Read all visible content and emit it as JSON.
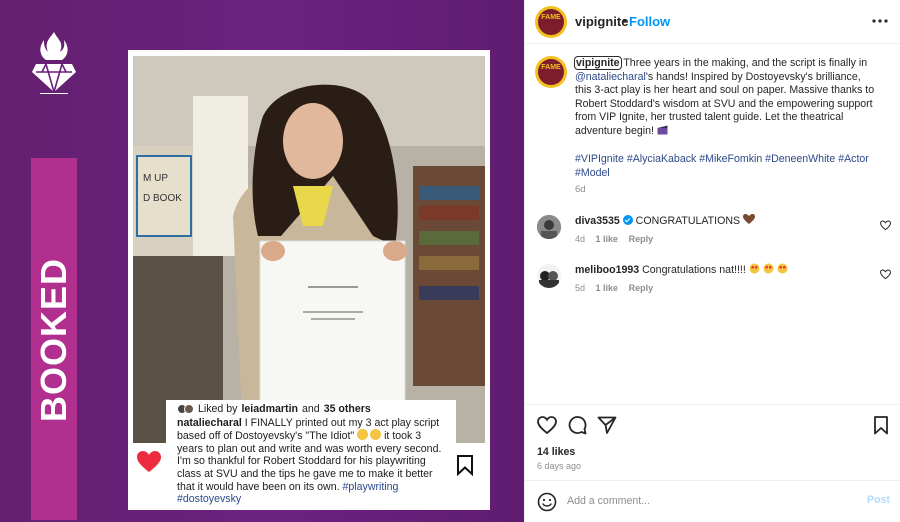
{
  "media": {
    "side_label": "BOOKED",
    "colors": {
      "purple": "#6a1f7b",
      "pink": "#b02f8f"
    },
    "embedded_post": {
      "liked_by_prefix": "Liked by",
      "liked_by_user": "leiadmartin",
      "liked_by_and": "and",
      "liked_by_others": "35 others",
      "caption_user": "nataliecharal",
      "caption_text": "I FINALLY printed out my 3 act play script based off of Dostoyevsky's \"The Idiot\"",
      "caption_text_2": "it took 3 years to plan out and write and was worth every second. I'm so thankful for Robert Stoddard for his playwriting class at SVU and the tips he gave me to make it better that it would have been on its own.",
      "hashtags": "#playwriting #dostoyevsky"
    }
  },
  "header": {
    "username": "vipignite",
    "dot": "•",
    "follow_label": "Follow",
    "avatar_text": "FAME",
    "more_icon": "more-horizontal-icon"
  },
  "caption": {
    "username": "vipignite",
    "text_1": "Three years in the making, and the script is finally in",
    "mention": "@nataliecharal",
    "text_2": "'s hands! Inspired by Dostoyevsky's brilliance, this 3-act play is her heart and soul on paper. Massive thanks to Robert Stoddard's wisdom at SVU and the empowering support from VIP Ignite, her trusted talent guide. Let the theatrical adventure begin!",
    "hashtags": "#VIPIgnite #AlyciaKaback #MikeFomkin #DeneenWhite #Actor #Model",
    "time": "6d"
  },
  "comments": [
    {
      "user": "diva3535",
      "text": "CONGRATULATIONS",
      "time": "4d",
      "likes": "1 like",
      "reply": "Reply"
    },
    {
      "user": "meliboo1993",
      "text": "Congratulations nat!!!!",
      "time": "5d",
      "likes": "1 like",
      "reply": "Reply"
    }
  ],
  "actions": {
    "likes": "14 likes",
    "date": "6 days ago"
  },
  "add_comment": {
    "placeholder": "Add a comment...",
    "post_label": "Post"
  }
}
